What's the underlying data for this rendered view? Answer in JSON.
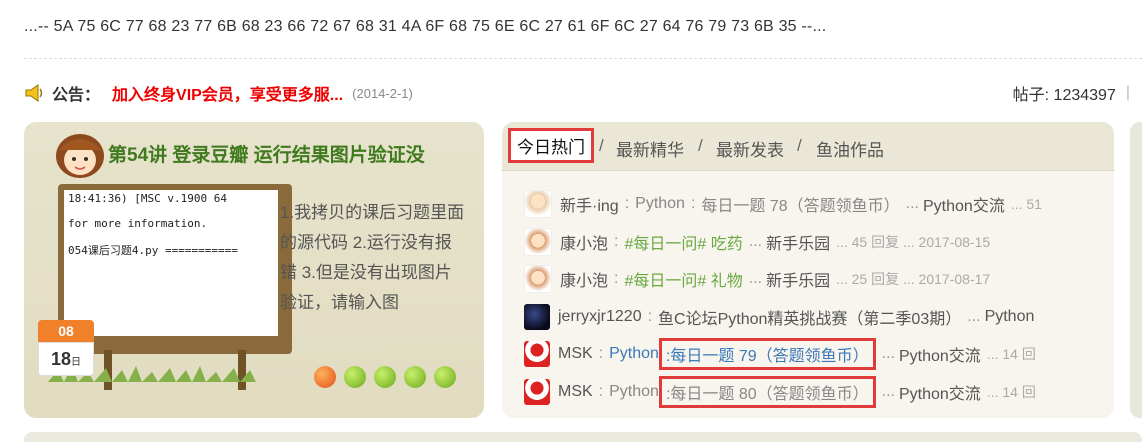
{
  "hex_line": "...-- 5A 75 6C 77 68 23 77 6B 68 23 66 72 67 68 31 4A 6F 68 75 6E 6C 27 61 6F 6C 27 64 76 79 73 6B 35 --...",
  "announcement": {
    "label": "公告：",
    "text": "加入终身VIP会员，享受更多服...",
    "date": "(2014-2-1)"
  },
  "posts_count": "帖子: 1234397",
  "posts_bar": "|",
  "banner": {
    "title": "第54讲 登录豆瓣 运行结果图片验证没",
    "code_lines": [
      "18:41:36) [MSC v.1900 64",
      "for more information.",
      "054课后习题4.py ==========="
    ],
    "description": "1.我拷贝的课后习题里面的源代码 2.运行没有报错 3.但是没有出现图片验证，请输入图",
    "calendar_month": "08",
    "calendar_day": "18",
    "calendar_day_suffix": "日"
  },
  "tabs": [
    {
      "label": "今日热门",
      "active": true
    },
    {
      "label": "最新精华",
      "active": false
    },
    {
      "label": "最新发表",
      "active": false
    },
    {
      "label": "鱼油作品",
      "active": false
    }
  ],
  "tab_separator": "/",
  "threads": [
    {
      "user": "新手·ing",
      "sep": ":",
      "prefix": "Python",
      "title": "每日一题 78（答题领鱼币）",
      "dots": "...",
      "forum": "Python交流",
      "meta": "... 51"
    },
    {
      "user": "康小泡",
      "sep": ":",
      "prefix": "",
      "title": "#每日一问# 吃药",
      "dots": "...",
      "forum": "新手乐园",
      "meta": "... 45 回复 ... 2017-08-15"
    },
    {
      "user": "康小泡",
      "sep": ":",
      "prefix": "",
      "title": "#每日一问# 礼物",
      "dots": "...",
      "forum": "新手乐园",
      "meta": "... 25 回复 ... 2017-08-17"
    },
    {
      "user": "jerryxjr1220",
      "sep": ":",
      "prefix": "",
      "title": "鱼C论坛Python精英挑战赛（第二季03期）",
      "dots": "...",
      "forum": "Python",
      "meta": ""
    },
    {
      "user": "MSK",
      "sep": ":",
      "prefix": "Python",
      "title": "每日一题 79（答题领鱼币）",
      "dots": "...",
      "forum": "Python交流",
      "meta": "... 14 回"
    },
    {
      "user": "MSK",
      "sep": ":",
      "prefix": "Python",
      "title": "每日一题 80（答题领鱼币）",
      "dots": "...",
      "forum": "Python交流",
      "meta": "... 14 回"
    }
  ],
  "colors": {
    "accent_red": "#e03a3a",
    "notice_red": "#e00000",
    "banner_title_green": "#3f7a1e",
    "tag_green": "#6aa842",
    "link_blue": "#3c79b8"
  },
  "icons": [
    "speaker-icon",
    "cartoon-girl-icon",
    "calendar-icon",
    "apple-icon",
    "avatar-icon"
  ]
}
